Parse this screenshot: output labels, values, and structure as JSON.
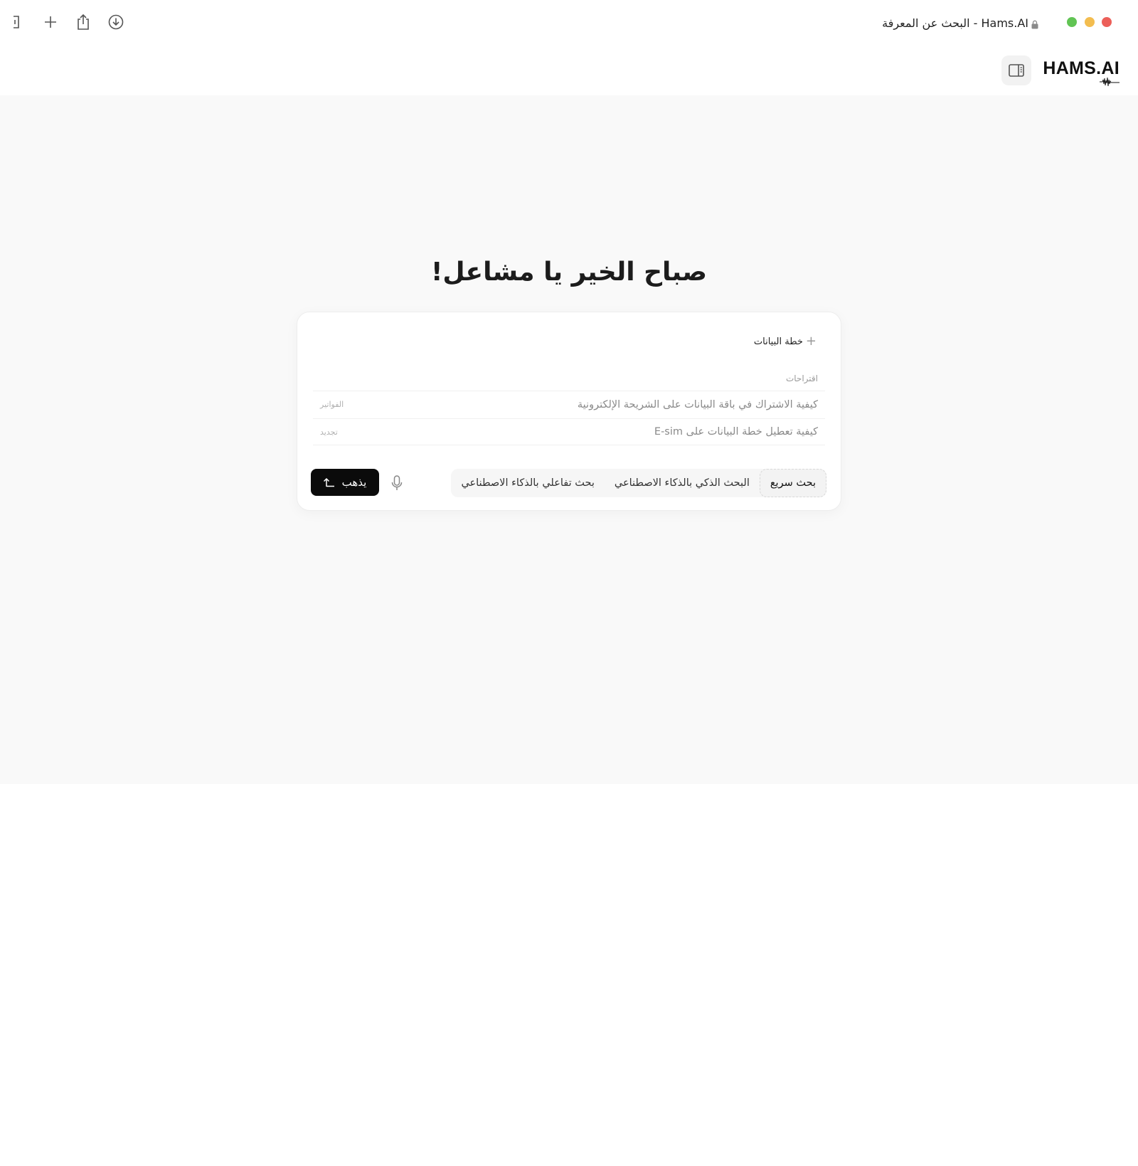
{
  "window": {
    "title": "البحث عن المعرفة - Hams.AI",
    "traffic_colors": {
      "close": "#ec5f59",
      "minimize": "#f3bd4f",
      "zoom": "#61c454"
    }
  },
  "toolbar_icons": [
    "sidebar-bracket-icon",
    "plus-icon",
    "share-icon",
    "download-icon"
  ],
  "header": {
    "logo_text": "HAMS.AI",
    "panel_toggle_icon": "panel-right-icon"
  },
  "main": {
    "greeting": "صباح الخير يا مشاعل!",
    "card": {
      "plan_chip": "خطة البيانات",
      "suggestions_label": "اقتراحات",
      "suggestions": [
        {
          "text": "كيفية الاشتراك في باقة البيانات على الشريحة الإلكترونية",
          "tag": "الفواتير"
        },
        {
          "text": "كيفية تعطيل خطة البيانات على E-sim",
          "tag": "تجديد"
        }
      ],
      "modes": [
        {
          "label": "بحث سريع",
          "active": true
        },
        {
          "label": "البحث الذكي بالذكاء الاصطناعي",
          "active": false
        },
        {
          "label": "بحث تفاعلي بالذكاء الاصطناعي",
          "active": false
        }
      ],
      "go_button": "يذهب"
    }
  }
}
